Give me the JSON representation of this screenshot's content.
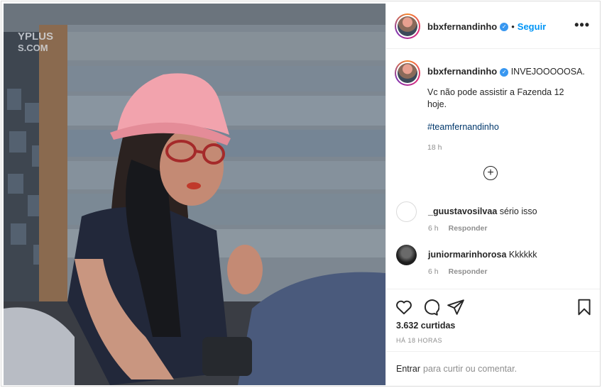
{
  "post": {
    "username": "bbxfernandinho",
    "follow_label": "Seguir",
    "more_label": "•••",
    "verified_mark": "✓",
    "caption_headline": "INVEJOOOOOSA.",
    "caption_line": "Vc não pode assistir a Fazenda 12 hoje.",
    "hashtag": "#teamfernandinho",
    "caption_time": "18 h",
    "load_more_glyph": "+"
  },
  "comments": [
    {
      "username": "_guustavosilvaa",
      "text": "sério isso",
      "time": "6 h",
      "reply_label": "Responder"
    },
    {
      "username": "juniormarinhorosa",
      "text": "Kkkkkk",
      "time": "6 h",
      "reply_label": "Responder"
    }
  ],
  "actions": {
    "icons": [
      "heart-icon",
      "comment-icon",
      "share-icon",
      "bookmark-icon"
    ],
    "likes": "3.632 curtidas",
    "posted_ago": "HÁ 18 HORAS",
    "login_link": "Entrar",
    "login_text": "para curtir ou comentar."
  },
  "media": {
    "watermark": "YPLUS",
    "watermark_sub": "S.COM"
  },
  "colors": {
    "link_blue": "#0095f6",
    "hashtag": "#00376b",
    "muted": "#8e8e8e",
    "verified": "#3897f0"
  }
}
